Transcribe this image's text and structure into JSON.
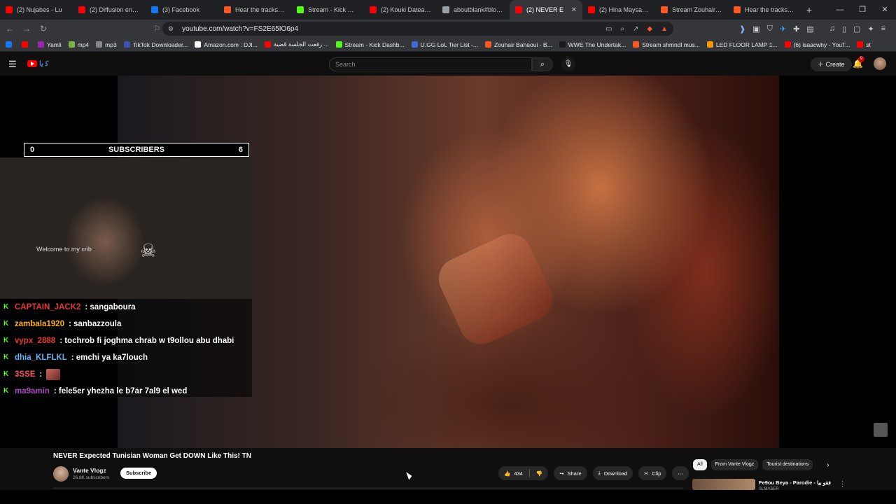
{
  "browser": {
    "tabs": [
      {
        "label": "(2) Nujabes - Lu",
        "fav": "#ff0000"
      },
      {
        "label": "(2) Diffusion en dire",
        "fav": "#ff0000"
      },
      {
        "label": "(3) Facebook",
        "fav": "#1877f2"
      },
      {
        "label": "Hear the tracks you",
        "fav": "#ff5722"
      },
      {
        "label": "Stream - Kick Dashb",
        "fav": "#53fc18"
      },
      {
        "label": "(2) Kouki Dateacher",
        "fav": "#ff0000"
      },
      {
        "label": "aboutblank#blocke",
        "fav": "#9aa0a6"
      },
      {
        "label": "(2) NEVER E",
        "fav": "#ff0000",
        "active": true
      },
      {
        "label": "(2) Hina Maysara X",
        "fav": "#ff0000"
      },
      {
        "label": "Stream Zouhair Bah",
        "fav": "#ff5722"
      },
      {
        "label": "Hear the tracks you",
        "fav": "#ff5722"
      }
    ],
    "url": "youtube.com/watch?v=FS2E65IO6p4",
    "bookmarks": [
      {
        "label": "",
        "color": "#1877f2"
      },
      {
        "label": "",
        "color": "#ff0000"
      },
      {
        "label": "Yamli",
        "color": "#9c27b0"
      },
      {
        "label": "mp4",
        "color": "#7cb342"
      },
      {
        "label": "mp3",
        "color": "#888"
      },
      {
        "label": "TikTok Downloader...",
        "color": "#3f51b5"
      },
      {
        "label": "Amazon.com : DJI...",
        "color": "#fff"
      },
      {
        "label": "رفعت الجلسة قضية ...",
        "color": "#ff0000"
      },
      {
        "label": "Stream - Kick Dashb...",
        "color": "#53fc18"
      },
      {
        "label": "U.GG LoL Tier List -...",
        "color": "#3f6ad8"
      },
      {
        "label": "Zouhair Bahaoui - B...",
        "color": "#ff5722"
      },
      {
        "label": "WWE The Undertak...",
        "color": "#1a1a1a"
      },
      {
        "label": "Stream shmndl mus...",
        "color": "#ff5722"
      },
      {
        "label": "LED FLOOR LAMP 1...",
        "color": "#ff9800"
      },
      {
        "label": "(6) isaacwhy - YouT...",
        "color": "#ff0000"
      },
      {
        "label": "st",
        "color": "#ff0000"
      }
    ]
  },
  "youtube": {
    "search_placeholder": "Search",
    "create_label": "Create",
    "notif_count": "9"
  },
  "stream_overlay": {
    "sub_left": "0",
    "sub_label": "SUBSCRIBERS",
    "sub_right": "6",
    "welcome": "Welcome to my crib",
    "chat": [
      {
        "user": "CAPTAIN_JACK2",
        "color": "#e53935",
        "msg": ": sangaboura"
      },
      {
        "user": "zambala1920",
        "color": "#ffb300",
        "msg": ": sanbazzoula"
      },
      {
        "user": "vypx_2888",
        "color": "#e53935",
        "msg": ": tochrob fi joghma chrab w t9ollou abu dhabi"
      },
      {
        "user": "dhia_KLFLKL",
        "color": "#64b5f6",
        "msg": ": emchi ya ka7louch"
      },
      {
        "user": "3SSE",
        "color": "#ff5252",
        "msg": ":"
      },
      {
        "user": "ma9amin",
        "color": "#ab47bc",
        "msg": ": fele5er yhezha le b7ar 7al9 el wed"
      }
    ]
  },
  "video": {
    "title": "NEVER Expected Tunisian Woman Get DOWN Like This! TN",
    "channel": "Vante Vlogz",
    "subs": "26.8K subscribers",
    "subscribe": "Subscribe",
    "likes": "434",
    "share": "Share",
    "download": "Download",
    "clip": "Clip"
  },
  "sidebar": {
    "chips": [
      "All",
      "From Vante Vlogz",
      "Tourist destinations"
    ],
    "rec_title": "Fe9ou Beya - Parodie - فقو بيا",
    "rec_channel": "SLMASER"
  }
}
